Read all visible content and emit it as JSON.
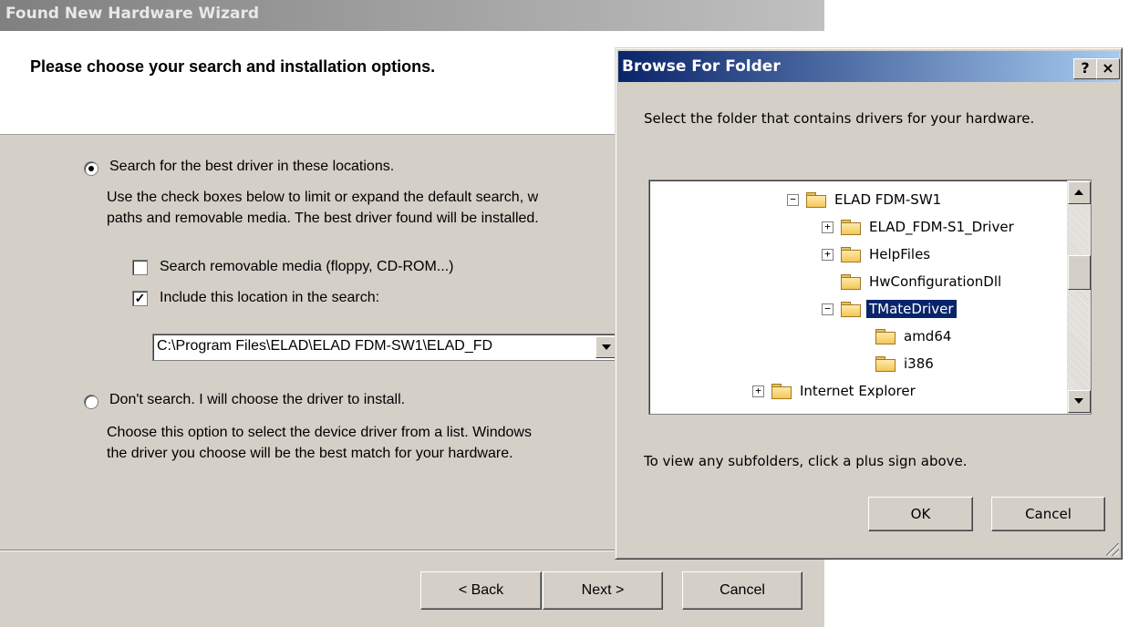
{
  "wizard": {
    "title": "Found New Hardware Wizard",
    "heading": "Please choose your search and installation options.",
    "option_search": {
      "label": "Search for the best driver in these locations.",
      "selected": true,
      "desc_line1": "Use the check boxes below to limit or expand the default search, w",
      "desc_line2": "paths and removable media. The best driver found will be installed."
    },
    "check_removable": {
      "label": "Search removable media (floppy, CD-ROM...)",
      "checked": false
    },
    "check_location": {
      "label": "Include this location in the search:",
      "checked": true
    },
    "location_value": "C:\\Program Files\\ELAD\\ELAD FDM-SW1\\ELAD_FD",
    "option_dont_search": {
      "label": "Don't search. I will choose the driver to install.",
      "selected": false,
      "desc_line1": "Choose this option to select the device driver from a list.  Windows",
      "desc_line2": "the driver you choose will be the best match for your hardware."
    },
    "buttons": {
      "back": "< Back",
      "next": "Next >",
      "cancel": "Cancel"
    }
  },
  "browse": {
    "title": "Browse For Folder",
    "help_label": "?",
    "close_label": "×",
    "instruction": "Select the folder that contains drivers for your hardware.",
    "tree": [
      {
        "label": "ELAD FDM-SW1",
        "expander": "−",
        "selected": false
      },
      {
        "label": "ELAD_FDM-S1_Driver",
        "expander": "+",
        "selected": false
      },
      {
        "label": "HelpFiles",
        "expander": "+",
        "selected": false
      },
      {
        "label": "HwConfigurationDll",
        "expander": "",
        "selected": false
      },
      {
        "label": "TMateDriver",
        "expander": "−",
        "selected": true
      },
      {
        "label": "amd64",
        "expander": "",
        "selected": false
      },
      {
        "label": "i386",
        "expander": "",
        "selected": false
      },
      {
        "label": "Internet Explorer",
        "expander": "+",
        "selected": false
      }
    ],
    "hint": "To view any subfolders, click a plus sign above.",
    "ok": "OK",
    "cancel": "Cancel"
  }
}
